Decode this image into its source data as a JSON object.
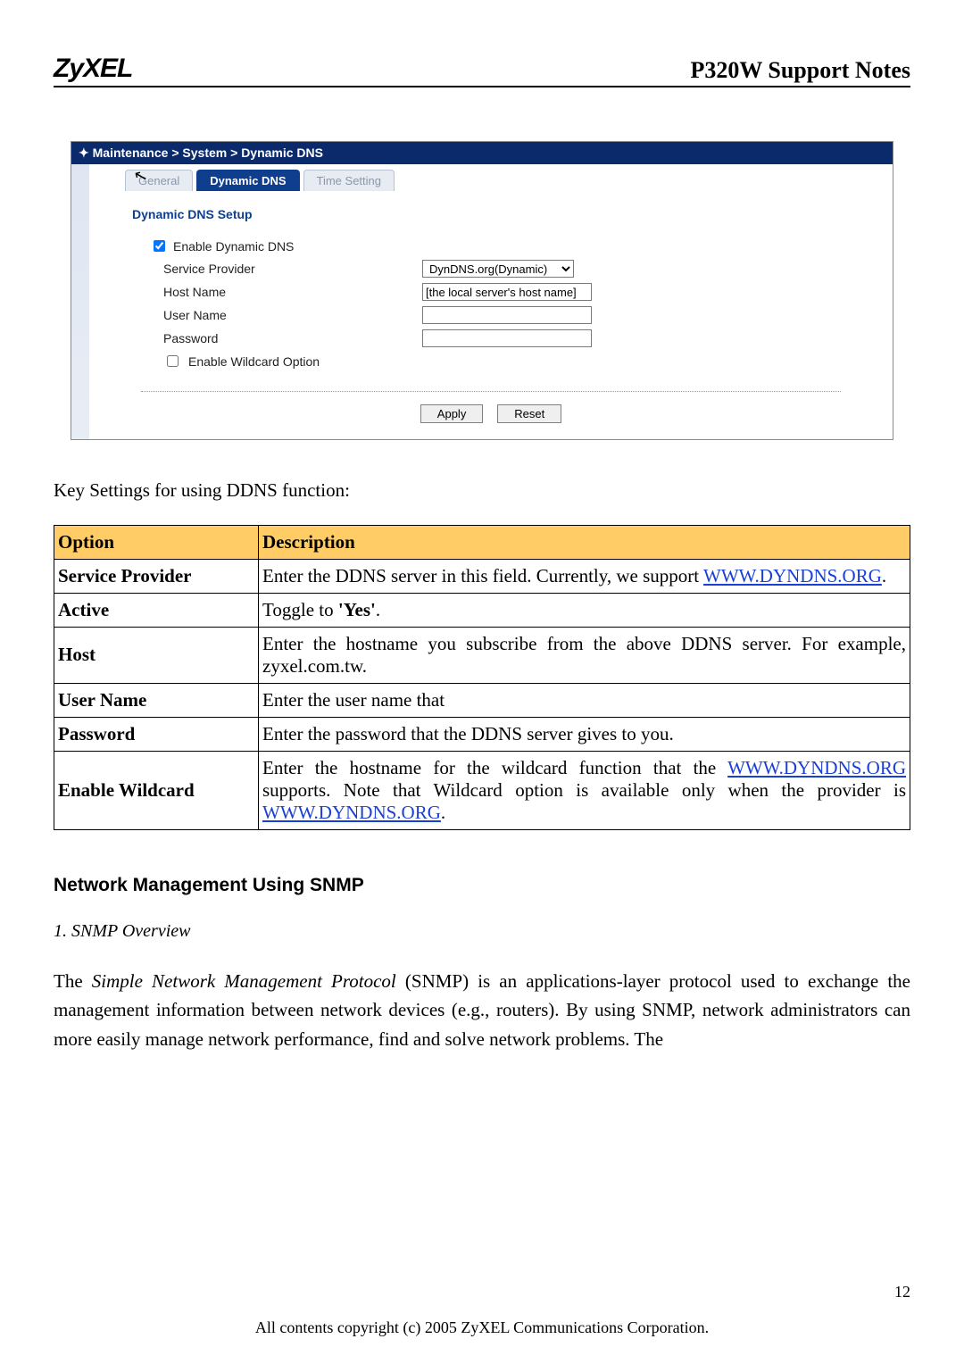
{
  "header": {
    "logo": "ZyXEL",
    "doc_title": "P320W Support Notes"
  },
  "screenshot": {
    "breadcrumb": [
      "Maintenance",
      "System",
      "Dynamic DNS"
    ],
    "cursor_name": "pointer-cursor",
    "tabs": [
      "General",
      "Dynamic DNS",
      "Time Setting"
    ],
    "active_tab_index": 1,
    "section_title": "Dynamic DNS Setup",
    "fields": {
      "enable_ddns": {
        "label": "Enable Dynamic DNS",
        "checked": true
      },
      "service_provider": {
        "label": "Service Provider",
        "option": "DynDNS.org(Dynamic)"
      },
      "host_name": {
        "label": "Host Name",
        "value": "[the local server's host name]"
      },
      "user_name": {
        "label": "User Name",
        "value": ""
      },
      "password": {
        "label": "Password",
        "value": ""
      },
      "wildcard": {
        "label": "Enable Wildcard Option",
        "checked": false
      }
    },
    "buttons": {
      "apply": "Apply",
      "reset": "Reset"
    }
  },
  "intro_text": "Key Settings for using DDNS function:",
  "table": {
    "headers": [
      "Option",
      "Description"
    ],
    "rows": [
      {
        "option": "Service Provider",
        "desc_pre": "Enter the DDNS server in this field. Currently, we support ",
        "link1": "WWW.DYNDNS.ORG",
        "desc_post": "."
      },
      {
        "option": "Active",
        "desc_pre": "Toggle to ",
        "bold": "'Yes'",
        "desc_post": "."
      },
      {
        "option": "Host",
        "desc_pre": "Enter the hostname you subscribe from the above DDNS server. For example, zyxel.com.tw."
      },
      {
        "option": "User Name",
        "desc_pre": "Enter the user name that"
      },
      {
        "option": "Password",
        "desc_pre": "Enter the password that the DDNS server gives to you."
      },
      {
        "option": "Enable Wildcard",
        "desc_pre": "Enter the hostname for the wildcard function that the ",
        "link1": "WWW.DYNDNS.ORG",
        "desc_mid": " supports. Note that Wildcard option is available only when the provider is ",
        "link2": "WWW.DYNDNS.ORG",
        "desc_post": "."
      }
    ]
  },
  "section_heading": "Network Management Using SNMP",
  "sub_heading": "1. SNMP Overview",
  "paragraph": {
    "pre": "The ",
    "italic": "Simple Network Management Protocol",
    "post": " (SNMP) is an applications-layer protocol used to exchange the management information between network devices (e.g., routers). By using SNMP, network administrators can more easily manage network performance, find and solve network problems. The"
  },
  "page_number": "12",
  "footer": "All contents copyright (c) 2005 ZyXEL Communications Corporation."
}
